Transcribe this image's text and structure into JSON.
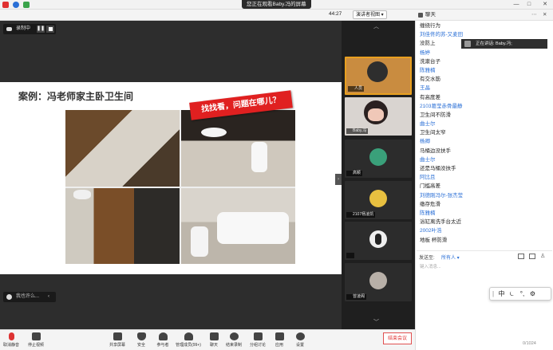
{
  "window": {
    "viewing_label": "您正在观看Baby.冯的屏幕",
    "clock": "44:27",
    "view_select": "演讲者视图",
    "controls": {
      "minimize": "—",
      "maximize": "□",
      "close": "✕"
    }
  },
  "recording": {
    "label": "录制中"
  },
  "slide": {
    "title": "案例：冯老师家主卧卫生间",
    "tag": "找找看，问题在哪儿？"
  },
  "chat_mini": {
    "label": "我也许么..."
  },
  "participants": [
    {
      "name": "人员"
    },
    {
      "name": "Baby.冯"
    },
    {
      "name": "高颖"
    },
    {
      "name": "2107杨凌凯"
    },
    {
      "name": ""
    },
    {
      "name": "曾凌阁"
    }
  ],
  "toolbar": {
    "items": [
      {
        "label": "取消静音"
      },
      {
        "label": "停止视频"
      },
      {
        "label": "共享屏幕"
      },
      {
        "label": "安全"
      },
      {
        "label": "参与者"
      },
      {
        "label": "管理成员(99+)"
      },
      {
        "label": "聊天"
      },
      {
        "label": "结束录制"
      },
      {
        "label": "分组讨论"
      },
      {
        "label": "应用"
      },
      {
        "label": "设置"
      }
    ],
    "end_button": "结束会议"
  },
  "chat": {
    "header": "聊天",
    "speaking": "正在讲话: Baby.冯;",
    "messages": [
      {
        "kind": "text",
        "text": "缠绕行为"
      },
      {
        "kind": "user",
        "text": "刘佳佟的苏-又麦田"
      },
      {
        "kind": "text",
        "text": "没防上"
      },
      {
        "kind": "user",
        "text": "杨婷"
      },
      {
        "kind": "text",
        "text": "洗漱台子"
      },
      {
        "kind": "user",
        "text": "陈雅楠"
      },
      {
        "kind": "text",
        "text": "有交水筋"
      },
      {
        "kind": "user",
        "text": "王晶"
      },
      {
        "kind": "text",
        "text": "有高度差"
      },
      {
        "kind": "user",
        "text": "2103葛莹赤骨最静"
      },
      {
        "kind": "text",
        "text": "卫生间不防滑"
      },
      {
        "kind": "user",
        "text": "曲士尔"
      },
      {
        "kind": "text",
        "text": "卫生间太窄"
      },
      {
        "kind": "user",
        "text": "杨卿"
      },
      {
        "kind": "text",
        "text": "马桶边没扶手"
      },
      {
        "kind": "user",
        "text": "曲士尔"
      },
      {
        "kind": "text",
        "text": "还是马桶没扶手"
      },
      {
        "kind": "user",
        "text": "阿比且"
      },
      {
        "kind": "text",
        "text": "门槛高差"
      },
      {
        "kind": "user",
        "text": "刘德刚冯尔-张杰莹"
      },
      {
        "kind": "text",
        "text": "缴存危滑"
      },
      {
        "kind": "user",
        "text": "陈雅楠"
      },
      {
        "kind": "text",
        "text": "浴缸离洗手台太近"
      },
      {
        "kind": "user",
        "text": "2002叶浩"
      },
      {
        "kind": "text",
        "text": "地板 杯防滑"
      }
    ],
    "send_to_label": "发送至:",
    "send_to_value": "所有人 ▾",
    "input_placeholder": "键入消息...",
    "counter": "0/1024"
  },
  "ime": {
    "items": [
      "中",
      "⏾",
      "°,",
      "⚙"
    ]
  },
  "colors": {
    "accent": "#2a6fd6",
    "end": "#e03030",
    "tag": "#e02020"
  }
}
